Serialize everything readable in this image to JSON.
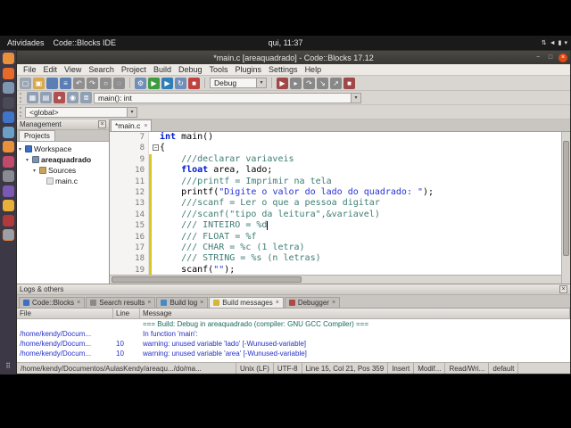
{
  "glyphs": {
    "close": "×",
    "dropdown": "▾",
    "expanded": "▾",
    "fold": "−",
    "minimize": "−",
    "maximize": "□",
    "apps_grid": "⠿"
  },
  "top_bar": {
    "activities": "Atividades",
    "app_name": "Code::Blocks IDE",
    "clock": "qui, 11:37",
    "system_icons": [
      {
        "name": "network-icon",
        "glyph": "⇅"
      },
      {
        "name": "volume-icon",
        "glyph": "◄"
      },
      {
        "name": "battery-icon",
        "glyph": "▮"
      },
      {
        "name": "dropdown-caret-icon",
        "glyph": "▾"
      }
    ]
  },
  "launcher": {
    "icons": [
      {
        "name": "files",
        "color": "#e8913a"
      },
      {
        "name": "firefox",
        "color": "#e66a2a"
      },
      {
        "name": "mail",
        "color": "#7f96b0"
      },
      {
        "name": "terminal",
        "color": "#4a4a55"
      },
      {
        "name": "writer",
        "color": "#3f74c9"
      },
      {
        "name": "help",
        "color": "#6aa0c8"
      },
      {
        "name": "software",
        "color": "#e8913a"
      },
      {
        "name": "settings",
        "color": "#c04a6a"
      },
      {
        "name": "trash",
        "color": "#8a8a92"
      },
      {
        "name": "rhythmbox",
        "color": "#7a5ab0"
      },
      {
        "name": "amazon",
        "color": "#e8b03a"
      },
      {
        "name": "libreoffice",
        "color": "#b03a3a"
      },
      {
        "name": "codeblocks",
        "color": "#9aa0a8",
        "active": true
      }
    ]
  },
  "window": {
    "title": "*main.c [areaquadrado] - Code::Blocks 17.12"
  },
  "menu": [
    "File",
    "Edit",
    "View",
    "Search",
    "Project",
    "Build",
    "Debug",
    "Tools",
    "Plugins",
    "Settings",
    "Help"
  ],
  "toolbar_main": [
    {
      "type": "icon",
      "name": "new-file",
      "glyph": "▢",
      "color": "#9aa6b2"
    },
    {
      "type": "icon",
      "name": "open-file",
      "glyph": "▣",
      "color": "#d9a84e"
    },
    {
      "type": "icon",
      "name": "save",
      "glyph": "",
      "color": "#5b7fb4"
    },
    {
      "type": "icon",
      "name": "save-all",
      "glyph": "≡",
      "color": "#5b7fb4"
    },
    {
      "type": "icon",
      "name": "undo",
      "glyph": "↶",
      "color": "#8f8f8f"
    },
    {
      "type": "icon",
      "name": "redo",
      "glyph": "↷",
      "color": "#8f8f8f"
    },
    {
      "type": "icon",
      "name": "find",
      "glyph": "○",
      "color": "#8f8f8f"
    },
    {
      "type": "icon",
      "name": "replace",
      "glyph": "◌",
      "color": "#8f8f8f"
    },
    {
      "type": "sep"
    },
    {
      "type": "icon",
      "name": "build",
      "glyph": "⚙",
      "color": "#6f8fb8"
    },
    {
      "type": "icon",
      "name": "run",
      "glyph": "▶",
      "color": "#3f9b3f"
    },
    {
      "type": "icon",
      "name": "build-and-run",
      "glyph": "▶",
      "color": "#2e7fb8"
    },
    {
      "type": "icon",
      "name": "rebuild",
      "glyph": "↻",
      "color": "#6f8fb8"
    },
    {
      "type": "icon",
      "name": "abort-build",
      "glyph": "■",
      "color": "#c14040"
    },
    {
      "type": "sep"
    },
    {
      "type": "combo",
      "name": "build-target-combo",
      "value": "Debug",
      "width": 64
    },
    {
      "type": "sep"
    },
    {
      "type": "icon",
      "name": "debug-continue",
      "glyph": "▶",
      "color": "#a04848"
    },
    {
      "type": "icon",
      "name": "run-to-cursor",
      "glyph": "▸",
      "color": "#888888"
    },
    {
      "type": "icon",
      "name": "step-next-line",
      "glyph": "↷",
      "color": "#888888"
    },
    {
      "type": "icon",
      "name": "step-into",
      "glyph": "↘",
      "color": "#888888"
    },
    {
      "type": "icon",
      "name": "step-out",
      "glyph": "↗",
      "color": "#888888"
    },
    {
      "type": "icon",
      "name": "stop-debugger",
      "glyph": "■",
      "color": "#a04848"
    }
  ],
  "toolbar_debug_extra": [
    {
      "name": "debugging-windows",
      "glyph": "▦",
      "color": "#90a0b4"
    },
    {
      "name": "various-info",
      "glyph": "▤",
      "color": "#90a0b4"
    },
    {
      "name": "breakpoints",
      "glyph": "●",
      "color": "#b05050"
    },
    {
      "name": "watches",
      "glyph": "◉",
      "color": "#90a0b4"
    },
    {
      "name": "call-stack",
      "glyph": "≣",
      "color": "#90a0b4"
    }
  ],
  "function_combo": "main(): int",
  "scope_combo": "<global>",
  "management": {
    "caption": "Management",
    "tab": "Projects",
    "tree": [
      {
        "label": "Workspace",
        "level": 0,
        "children": true,
        "icon": "workspace",
        "color": "#3b6fc4"
      },
      {
        "label": "areaquadrado",
        "level": 1,
        "children": true,
        "bold": true,
        "icon": "project",
        "color": "#7d93ad"
      },
      {
        "label": "Sources",
        "level": 2,
        "children": true,
        "icon": "folder",
        "color": "#c9a35a"
      },
      {
        "label": "main.c",
        "level": 3,
        "children": false,
        "icon": "c-file",
        "color": "#e3e1de"
      }
    ]
  },
  "editor": {
    "tab": "*main.c",
    "lines": [
      {
        "n": 7,
        "chg": false,
        "seg": [
          {
            "c": "kw",
            "t": "int"
          },
          {
            "c": "pl",
            "t": " main()"
          }
        ]
      },
      {
        "n": 8,
        "chg": false,
        "fold": true,
        "seg": [
          {
            "c": "pl",
            "t": "{"
          }
        ]
      },
      {
        "n": 9,
        "chg": true,
        "seg": [
          {
            "c": "cm",
            "t": "    ///declarar variaveis"
          }
        ]
      },
      {
        "n": 10,
        "chg": true,
        "seg": [
          {
            "c": "pl",
            "t": "    "
          },
          {
            "c": "kw",
            "t": "float"
          },
          {
            "c": "pl",
            "t": " area, lado;"
          }
        ]
      },
      {
        "n": 11,
        "chg": true,
        "seg": [
          {
            "c": "cm",
            "t": "    ///printf = Imprimir na tela"
          }
        ]
      },
      {
        "n": 12,
        "chg": true,
        "seg": [
          {
            "c": "pl",
            "t": "    printf("
          },
          {
            "c": "str",
            "t": "\"Digite o valor do lado do quadrado: \""
          },
          {
            "c": "pl",
            "t": ");"
          }
        ]
      },
      {
        "n": 13,
        "chg": true,
        "seg": [
          {
            "c": "cm",
            "t": "    ///scanf = Ler o que a pessoa digitar"
          }
        ]
      },
      {
        "n": 14,
        "chg": true,
        "seg": [
          {
            "c": "cm",
            "t": "    ///scanf(\"tipo da leitura\",&variavel)"
          }
        ]
      },
      {
        "n": 15,
        "chg": true,
        "cursor": true,
        "seg": [
          {
            "c": "cm",
            "t": "    /// INTEIRO = %d"
          }
        ]
      },
      {
        "n": 16,
        "chg": true,
        "seg": [
          {
            "c": "cm",
            "t": "    /// FLOAT = %f"
          }
        ]
      },
      {
        "n": 17,
        "chg": true,
        "seg": [
          {
            "c": "cm",
            "t": "    /// CHAR = %c (1 letra)"
          }
        ]
      },
      {
        "n": 18,
        "chg": true,
        "seg": [
          {
            "c": "cm",
            "t": "    /// STRING = %s (n letras)"
          }
        ]
      },
      {
        "n": 19,
        "chg": true,
        "seg": [
          {
            "c": "pl",
            "t": "    scanf("
          },
          {
            "c": "str",
            "t": "\"\""
          },
          {
            "c": "pl",
            "t": ");"
          }
        ]
      }
    ]
  },
  "logs": {
    "caption": "Logs & others",
    "tabs": [
      {
        "label": "Code::Blocks",
        "color": "#3b6fc4",
        "active": false
      },
      {
        "label": "Search results",
        "color": "#8a8a8a",
        "active": false
      },
      {
        "label": "Build log",
        "color": "#4a8ac4",
        "active": false
      },
      {
        "label": "Build messages",
        "color": "#d4b63a",
        "active": true
      },
      {
        "label": "Debugger",
        "color": "#b04848",
        "active": false
      }
    ],
    "columns": [
      "File",
      "Line",
      "Message"
    ],
    "rows": [
      {
        "type": "build",
        "file": "",
        "line": "",
        "message": "=== Build: Debug in areaquadrado (compiler: GNU GCC Compiler) ==="
      },
      {
        "type": "warn",
        "file": "/home/kendy/Docum...",
        "line": "",
        "message": "In function 'main':"
      },
      {
        "type": "warn",
        "file": "/home/kendy/Docum...",
        "line": "10",
        "message": "warning: unused variable 'lado' [-Wunused-variable]"
      },
      {
        "type": "warn",
        "file": "/home/kendy/Docum...",
        "line": "10",
        "message": "warning: unused variable 'area' [-Wunused-variable]"
      }
    ]
  },
  "status": [
    "/home/kendy/Documentos/AulasKendy/areaqu.../do/ma...",
    "Unix (LF)",
    "UTF-8",
    "Line 15, Col 21, Pos 359",
    "Insert",
    "Modif...",
    "Read/Wri...",
    "default"
  ]
}
